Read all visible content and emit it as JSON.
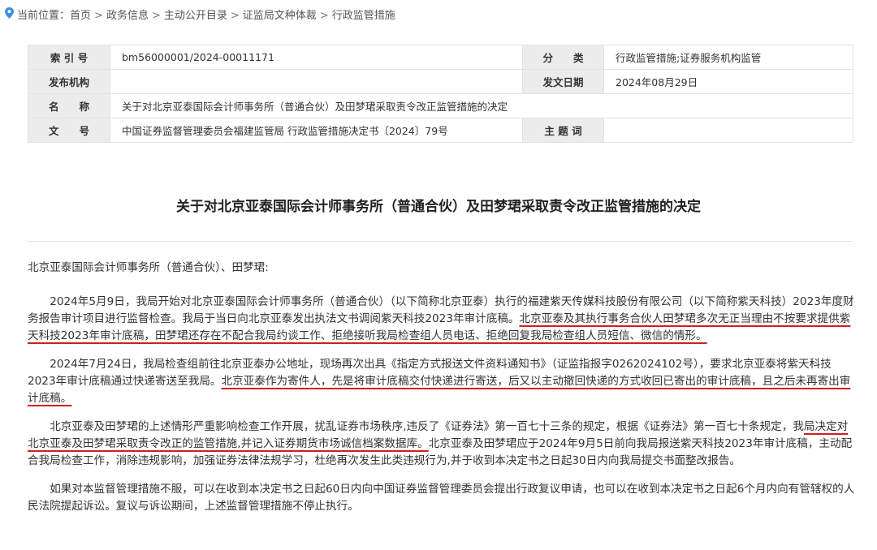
{
  "breadcrumb": {
    "prefix": "当前位置：",
    "items": [
      "首页",
      "政务信息",
      "主动公开目录",
      "证监局文种体裁",
      "行政监管措施"
    ],
    "separator": ">"
  },
  "meta": {
    "index_label": "索 引 号",
    "index_value": "bm56000001/2024-00011171",
    "category_label": "分　　类",
    "category_value": "行政监管措施;证券服务机构监管",
    "publisher_label": "发布机构",
    "publisher_value": "",
    "date_label": "发文日期",
    "date_value": "2024年08月29日",
    "name_label": "名　　称",
    "name_value": "关于对北京亚泰国际会计师事务所（普通合伙）及田梦珺采取责令改正监管措施的决定",
    "docno_label": "文　　号",
    "docno_value": "中国证券监督管理委员会福建监管局 行政监管措施决定书〔2024〕79号",
    "subject_label": "主 题 词",
    "subject_value": ""
  },
  "title": "关于对北京亚泰国际会计师事务所（普通合伙）及田梦珺采取责令改正监管措施的决定",
  "addressee": "北京亚泰国际会计师事务所（普通合伙）、田梦珺:",
  "paragraphs": {
    "p1_a": "2024年5月9日，我局开始对北京亚泰国际会计师事务所（普通合伙）（以下简称北京亚泰）执行的福建紫天传媒科技股份有限公司（以下简称紫天科技）2023年度财务报告审计项目进行监督检查。我局于当日向北京亚泰发出执法文书调阅紫天科技2023年审计底稿。",
    "p1_b": "北京亚泰及其执行事务合伙人田梦珺多次无正当理由不按要求提供紫天科技2023年审计底稿，田梦珺还存在不配合我局约谈工作、拒绝接听我局检查组人员电话、拒绝回复我局检查组人员短信、微信的情形。",
    "p2_a": "2024年7月24日，我局检查组前往北京亚泰办公地址，现场再次出具《指定方式报送文件资料通知书》（证监指报字0262024102号），要求北京亚泰将紫天科技2023年审计底稿通过快递寄送至我局。",
    "p2_b": "北京亚泰作为寄件人，先是将审计底稿交付快递进行寄送，后又以主动撤回快递的方式收回已寄出的审计底稿，且之后未再寄出审计底稿。",
    "p3_a": "北京亚泰及田梦珺的上述情形严重影响检查工作开展，扰乱证券市场秩序,违反了《证券法》第一百七十三条的规定，根据《证券法》第一百七十条规定，我",
    "p3_b": "局决定对北京亚泰及田梦珺采取责令改正的监管措施,并记入证券期货市场诚信档案数据库。",
    "p3_c": "北京亚泰及田梦珺应于2024年9月5日前向我局报送紫天科技2023年审计底稿，主动配合我局检查工作，消除违规影响，加强证券法律法规学习，杜绝再次发生此类违规行为,并于收到本决定书之日起30日内向我局提交书面整改报告。",
    "p4": "如果对本监督管理措施不服，可以在收到本决定书之日起60日内向中国证券监督管理委员会提出行政复议申请，也可以在收到本决定书之日起6个月内向有管辖权的人民法院提起诉讼。复议与诉讼期间，上述监督管理措施不停止执行。"
  },
  "colors": {
    "underline": "#d21e1e",
    "label_bg": "#ececec",
    "pin": "#3a8ee6"
  }
}
